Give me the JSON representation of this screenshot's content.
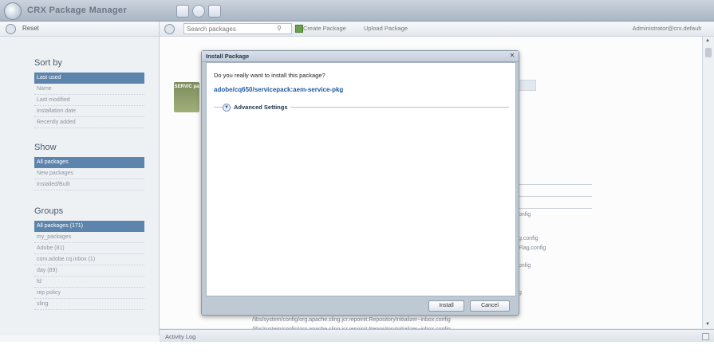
{
  "app": {
    "title": "CRX  Package Manager"
  },
  "sidebar": {
    "reset_label": "Reset",
    "sort": {
      "title": "Sort by",
      "items": [
        "Last used",
        "Name",
        "Last modified",
        "Installation date",
        "Recently added"
      ]
    },
    "show": {
      "title": "Show",
      "items": [
        "All packages",
        "New packages",
        "Installed/Built"
      ]
    },
    "groups": {
      "title": "Groups",
      "items": [
        "All packages (171)",
        "my_packages",
        "Adobe (81)",
        "com.adobe.cq.inbox (1)",
        "day (89)",
        "fd",
        "rep policy",
        "sling"
      ]
    }
  },
  "toolbar": {
    "search_placeholder": "Search packages",
    "create_label": "Create Package",
    "upload_label": "Upload Package",
    "user_label": "Administrator@crx.default"
  },
  "content": {
    "thumb_text": "SERVIC pa",
    "frag1": "onfig",
    "frag2": "g.config",
    "frag3": "Flag.config",
    "frag4": "onfig",
    "frag5": "g",
    "path_line_1": "/libs/system/config/org.apache.sling.jcr.repoinit.RepositoryInitializer~inbox.config",
    "path_line_2": "/libs/system/config/org.apache.sling.jcr.repoinit.RepositoryInitializer~inbox.config"
  },
  "activity_log": {
    "label": "Activity Log"
  },
  "dialog": {
    "title": "Install Package",
    "question": "Do you really want to install this package?",
    "package_path": "adobe/cq650/servicepack:aem-service-pkg",
    "advanced_label": "Advanced Settings",
    "install_label": "Install",
    "cancel_label": "Cancel"
  }
}
